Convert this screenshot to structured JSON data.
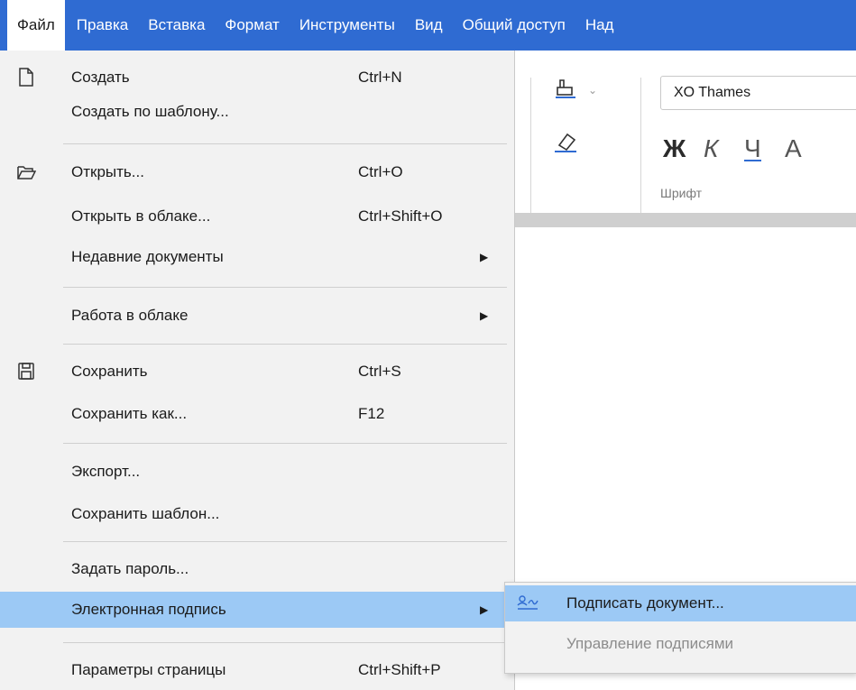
{
  "menubar": {
    "items": [
      "Файл",
      "Правка",
      "Вставка",
      "Формат",
      "Инструменты",
      "Вид",
      "Общий доступ",
      "Над"
    ]
  },
  "ribbon": {
    "font_name": "XO Thames",
    "bold_label": "Ж",
    "italic_label": "К",
    "underline_label": "Ч",
    "more_label": "А",
    "group_label": "Шрифт"
  },
  "file_menu": {
    "items": [
      {
        "label": "Создать",
        "shortcut": "Ctrl+N",
        "icon": "new-document-icon"
      },
      {
        "label": "Создать по шаблону...",
        "shortcut": ""
      },
      {
        "label": "Открыть...",
        "shortcut": "Ctrl+O",
        "icon": "open-folder-icon"
      },
      {
        "label": "Открыть в облаке...",
        "shortcut": "Ctrl+Shift+O"
      },
      {
        "label": "Недавние документы",
        "shortcut": "",
        "submenu": true
      },
      {
        "label": "Работа в облаке",
        "shortcut": "",
        "submenu": true
      },
      {
        "label": "Сохранить",
        "shortcut": "Ctrl+S",
        "icon": "save-icon"
      },
      {
        "label": "Сохранить как...",
        "shortcut": "F12"
      },
      {
        "label": "Экспорт...",
        "shortcut": ""
      },
      {
        "label": "Сохранить шаблон...",
        "shortcut": ""
      },
      {
        "label": "Задать пароль...",
        "shortcut": ""
      },
      {
        "label": "Электронная подпись",
        "shortcut": "",
        "submenu": true,
        "highlighted": true
      },
      {
        "label": "Параметры страницы",
        "shortcut": "Ctrl+Shift+P"
      }
    ]
  },
  "signature_submenu": {
    "items": [
      {
        "label": "Подписать документ...",
        "icon": "signature-icon",
        "highlighted": true
      },
      {
        "label": "Управление подписями",
        "disabled": true
      }
    ]
  },
  "colors": {
    "menubar_bg": "#2f6bd2",
    "menu_bg": "#f2f2f2",
    "highlight": "#9cc9f5"
  }
}
